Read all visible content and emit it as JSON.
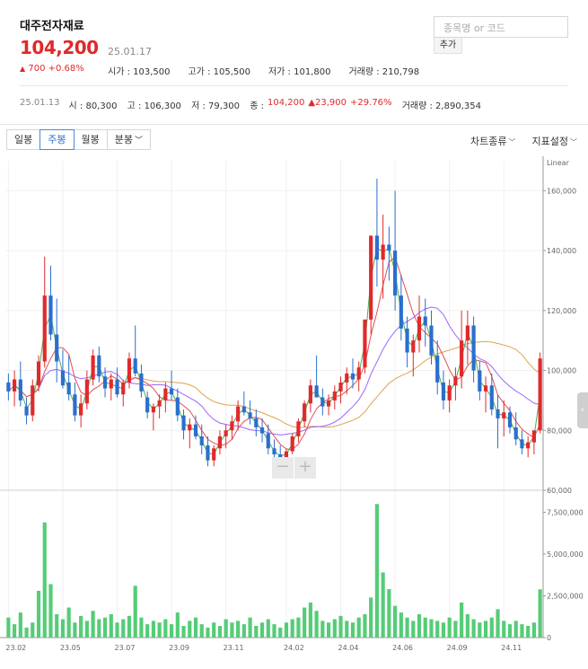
{
  "stock": {
    "name": "대주전자재료",
    "price": "104,200",
    "date": "25.01.17",
    "change_label": "700 +0.68%",
    "open_label": "시가 : 103,500",
    "high_label": "고가 : 105,500",
    "low_label": "저가 : 101,800",
    "volume_label": "거래량 : 210,798"
  },
  "search": {
    "placeholder": "종목명 or 코드",
    "add_label": "추가"
  },
  "week_info": {
    "date": "25.01.13",
    "open": "시 : 80,300",
    "high": "고 : 106,300",
    "low": "저 : 79,300",
    "close_label": "종 : ",
    "close": "104,200",
    "diff": "23,900",
    "pct": "+29.76%",
    "volume": "거래량 : 2,890,354"
  },
  "toolbar": {
    "tabs": [
      "일봉",
      "주봉",
      "월봉",
      "분봉"
    ],
    "active_tab": "주봉",
    "chart_type_label": "차트종류",
    "indicator_label": "지표설정"
  },
  "colors": {
    "up": "#e0292b",
    "down": "#2a6fcc",
    "volume": "#55cc77",
    "ma5": "#4caf50",
    "ma20": "#e05050",
    "ma60": "#9966ff",
    "ma120": "#e0a050"
  },
  "chart_data": {
    "type": "candlestick",
    "scale_label": "Linear",
    "price_axis": {
      "ylim": [
        60000,
        170000
      ],
      "ticks": [
        "60,000",
        "80,000",
        "100,000",
        "120,000",
        "140,000",
        "160,000"
      ]
    },
    "volume_axis": {
      "ylim": [
        0,
        8500000
      ],
      "ticks": [
        "0",
        "2,500,000",
        "5,000,000",
        "7,500,000"
      ]
    },
    "x_labels": [
      "23.02",
      "23.05",
      "23.07",
      "23.09",
      "23.11",
      "24.02",
      "24.04",
      "24.06",
      "24.09",
      "24.11"
    ],
    "x_label_index": [
      0,
      9,
      18,
      27,
      36,
      46,
      55,
      64,
      73,
      82
    ],
    "candles": [
      [
        96,
        99,
        90,
        93
      ],
      [
        93,
        100,
        88,
        97
      ],
      [
        97,
        103,
        88,
        90
      ],
      [
        88,
        91,
        82,
        85
      ],
      [
        85,
        97,
        83,
        95
      ],
      [
        95,
        105,
        93,
        103
      ],
      [
        103,
        138,
        101,
        125
      ],
      [
        125,
        135,
        110,
        112
      ],
      [
        112,
        124,
        96,
        103
      ],
      [
        100,
        107,
        94,
        95
      ],
      [
        96,
        105,
        90,
        92
      ],
      [
        92,
        96,
        83,
        85
      ],
      [
        85,
        92,
        81,
        89
      ],
      [
        89,
        100,
        87,
        97
      ],
      [
        97,
        107,
        95,
        105
      ],
      [
        105,
        108,
        96,
        98
      ],
      [
        98,
        101,
        91,
        94
      ],
      [
        94,
        99,
        90,
        97
      ],
      [
        97,
        101,
        91,
        92
      ],
      [
        92,
        97,
        88,
        96
      ],
      [
        96,
        106,
        94,
        104
      ],
      [
        104,
        115,
        98,
        99
      ],
      [
        99,
        102,
        91,
        93
      ],
      [
        91,
        93,
        84,
        86
      ],
      [
        86,
        89,
        80,
        88
      ],
      [
        88,
        92,
        84,
        90
      ],
      [
        90,
        96,
        86,
        94
      ],
      [
        94,
        100,
        90,
        92
      ],
      [
        91,
        94,
        83,
        85
      ],
      [
        85,
        87,
        77,
        80
      ],
      [
        80,
        84,
        74,
        82
      ],
      [
        82,
        85,
        77,
        78
      ],
      [
        78,
        82,
        72,
        75
      ],
      [
        75,
        78,
        68,
        70
      ],
      [
        70,
        75,
        68,
        74
      ],
      [
        74,
        80,
        72,
        78
      ],
      [
        78,
        82,
        74,
        80
      ],
      [
        80,
        85,
        77,
        83
      ],
      [
        83,
        90,
        80,
        88
      ],
      [
        88,
        93,
        85,
        86
      ],
      [
        86,
        90,
        82,
        84
      ],
      [
        84,
        87,
        78,
        81
      ],
      [
        81,
        84,
        76,
        79
      ],
      [
        79,
        82,
        72,
        74
      ],
      [
        74,
        77,
        70,
        72
      ],
      [
        72,
        75,
        68,
        71
      ],
      [
        71,
        74,
        69,
        73
      ],
      [
        73,
        79,
        72,
        78
      ],
      [
        78,
        84,
        76,
        83
      ],
      [
        83,
        90,
        81,
        89
      ],
      [
        89,
        97,
        86,
        95
      ],
      [
        95,
        105,
        92,
        91
      ],
      [
        91,
        94,
        85,
        88
      ],
      [
        88,
        92,
        85,
        90
      ],
      [
        90,
        95,
        87,
        93
      ],
      [
        93,
        98,
        89,
        96
      ],
      [
        96,
        101,
        92,
        99
      ],
      [
        99,
        104,
        94,
        97
      ],
      [
        97,
        103,
        93,
        101
      ],
      [
        101,
        112,
        99,
        117
      ],
      [
        117,
        128,
        112,
        145
      ],
      [
        145,
        164,
        128,
        137
      ],
      [
        137,
        152,
        124,
        142
      ],
      [
        142,
        148,
        130,
        140
      ],
      [
        140,
        160,
        120,
        125
      ],
      [
        125,
        132,
        110,
        114
      ],
      [
        114,
        118,
        101,
        106
      ],
      [
        106,
        112,
        98,
        110
      ],
      [
        110,
        125,
        106,
        118
      ],
      [
        118,
        124,
        108,
        115
      ],
      [
        115,
        120,
        102,
        105
      ],
      [
        105,
        110,
        92,
        96
      ],
      [
        96,
        100,
        87,
        90
      ],
      [
        90,
        97,
        86,
        95
      ],
      [
        95,
        101,
        90,
        98
      ],
      [
        98,
        120,
        94,
        110
      ],
      [
        110,
        120,
        102,
        115
      ],
      [
        115,
        118,
        96,
        100
      ],
      [
        100,
        103,
        90,
        93
      ],
      [
        93,
        98,
        86,
        95
      ],
      [
        95,
        99,
        85,
        87
      ],
      [
        87,
        92,
        74,
        84
      ],
      [
        84,
        90,
        78,
        86
      ],
      [
        86,
        88,
        79,
        81
      ],
      [
        81,
        86,
        75,
        77
      ],
      [
        77,
        80,
        72,
        74
      ],
      [
        74,
        78,
        71,
        76
      ],
      [
        76,
        79,
        72,
        80
      ],
      [
        80,
        106,
        79,
        104
      ]
    ],
    "volumes": [
      1.2,
      0.8,
      1.5,
      0.6,
      0.9,
      2.8,
      6.9,
      3.2,
      1.4,
      1.1,
      1.8,
      0.9,
      1.3,
      1.0,
      1.6,
      1.1,
      1.2,
      1.4,
      0.9,
      1.1,
      1.3,
      3.1,
      1.2,
      0.8,
      1.0,
      0.9,
      1.1,
      0.8,
      1.5,
      0.7,
      1.0,
      1.2,
      0.8,
      0.6,
      0.9,
      0.7,
      1.1,
      0.9,
      1.0,
      0.8,
      1.2,
      0.7,
      0.9,
      1.1,
      0.8,
      0.6,
      0.9,
      1.1,
      1.2,
      1.8,
      2.1,
      1.6,
      1.0,
      0.9,
      1.1,
      1.3,
      1.0,
      0.9,
      1.2,
      1.4,
      2.4,
      8.0,
      3.9,
      2.9,
      1.9,
      1.5,
      1.2,
      1.0,
      1.4,
      1.2,
      1.1,
      1.0,
      0.9,
      1.2,
      1.0,
      2.1,
      1.4,
      1.1,
      0.9,
      1.0,
      1.2,
      1.7,
      1.0,
      0.8,
      1.0,
      0.8,
      0.7,
      0.9,
      2.89
    ]
  }
}
